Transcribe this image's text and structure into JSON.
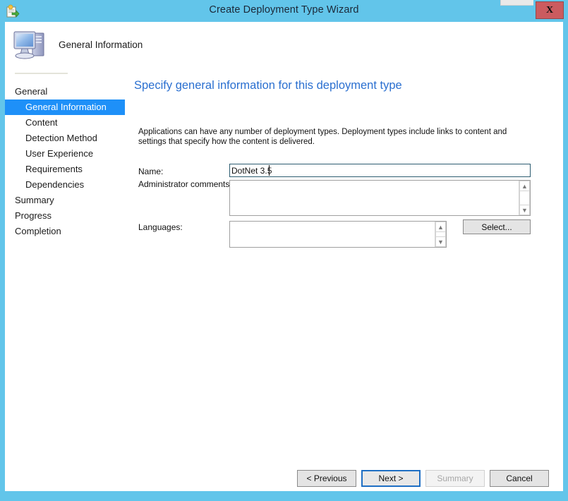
{
  "window": {
    "title": "Create Deployment Type Wizard",
    "icon": "deployment-package-icon",
    "close_label": "X",
    "frame_color": "#62c5ea"
  },
  "header": {
    "icon": "computer-monitor-icon",
    "title": "General Information"
  },
  "sidebar": {
    "items": [
      {
        "label": "General",
        "level": "group",
        "selected": false
      },
      {
        "label": "General Information",
        "level": "child",
        "selected": true
      },
      {
        "label": "Content",
        "level": "child",
        "selected": false
      },
      {
        "label": "Detection Method",
        "level": "child",
        "selected": false
      },
      {
        "label": "User Experience",
        "level": "child",
        "selected": false
      },
      {
        "label": "Requirements",
        "level": "child",
        "selected": false
      },
      {
        "label": "Dependencies",
        "level": "child",
        "selected": false
      },
      {
        "label": "Summary",
        "level": "group",
        "selected": false
      },
      {
        "label": "Progress",
        "level": "group",
        "selected": false
      },
      {
        "label": "Completion",
        "level": "group",
        "selected": false
      }
    ],
    "selected_color": "#1e90f8"
  },
  "main": {
    "heading": "Specify general information for this deployment type",
    "heading_color": "#2a6fd0",
    "description": "Applications can have any number of deployment types. Deployment types include links to content and settings that specify how the content is delivered.",
    "fields": {
      "name": {
        "label": "Name:",
        "value": "DotNet 3.5",
        "placeholder": "",
        "focused": true
      },
      "administrator_comments": {
        "label": "Administrator comments:",
        "value": "",
        "placeholder": ""
      },
      "languages": {
        "label": "Languages:",
        "value": "",
        "placeholder": "",
        "select_button": "Select..."
      }
    },
    "scroll_up_icon": "chevron-up-icon",
    "scroll_down_icon": "chevron-down-icon"
  },
  "footer": {
    "buttons": [
      {
        "label": "< Previous",
        "state": "enabled"
      },
      {
        "label": "Next >",
        "state": "default"
      },
      {
        "label": "Summary",
        "state": "disabled"
      },
      {
        "label": "Cancel",
        "state": "enabled"
      }
    ]
  }
}
